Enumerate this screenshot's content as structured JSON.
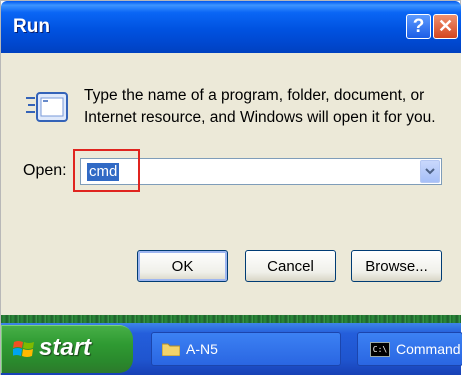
{
  "window": {
    "title": "Run",
    "help_glyph": "?",
    "close_glyph": "✕"
  },
  "dialog": {
    "description_line1": "Type the name of a program, folder, document, or",
    "description_line2": "Internet resource, and Windows will open it for you.",
    "open_label": "Open:",
    "open_value": "cmd",
    "icons": [
      "run-prompt-icon",
      "chevron-down-icon"
    ]
  },
  "buttons": {
    "ok": "OK",
    "cancel": "Cancel",
    "browse": "Browse..."
  },
  "taskbar": {
    "start_label": "start",
    "items": [
      {
        "label": "A-N5",
        "icon": "folder-icon"
      },
      {
        "label": "Command",
        "icon": "command-prompt-icon",
        "icon_text": "C:\\"
      }
    ]
  },
  "colors": {
    "titlebar": "#0a5be8",
    "dialog_bg": "#ece9d8",
    "selection": "#316ac5",
    "highlight_box": "#e0241f",
    "start_green": "#2f9a32",
    "taskbar_blue": "#245edb"
  }
}
